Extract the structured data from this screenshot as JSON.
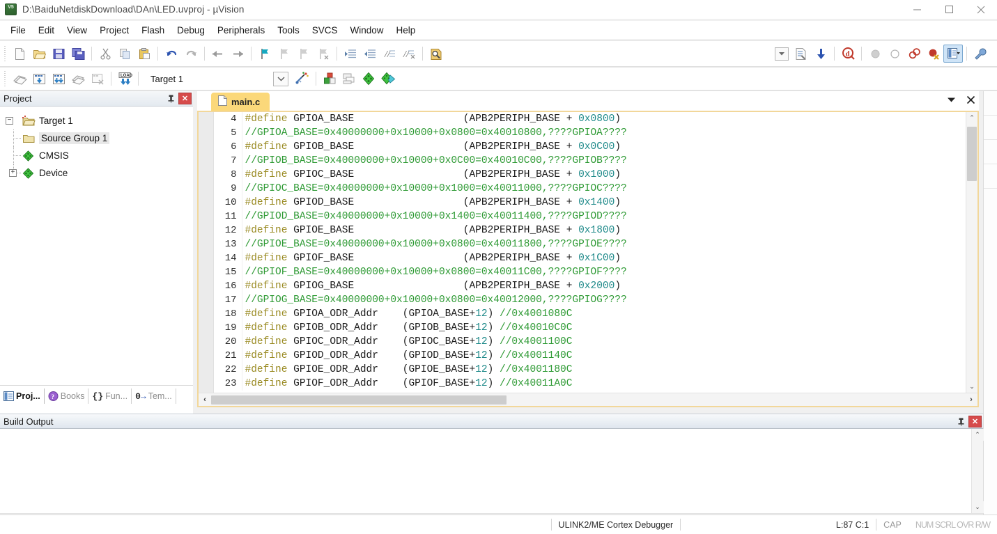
{
  "window": {
    "title": "D:\\BaiduNetdiskDownload\\DAn\\LED.uvproj - µVision",
    "icon": "uvision-logo-icon",
    "minimize": "—",
    "maximize": "□",
    "close": "✕"
  },
  "menu": {
    "items": [
      {
        "label": "File"
      },
      {
        "label": "Edit"
      },
      {
        "label": "View"
      },
      {
        "label": "Project"
      },
      {
        "label": "Flash"
      },
      {
        "label": "Debug"
      },
      {
        "label": "Peripherals"
      },
      {
        "label": "Tools"
      },
      {
        "label": "SVCS"
      },
      {
        "label": "Window"
      },
      {
        "label": "Help"
      }
    ]
  },
  "toolbar1": {
    "icons": [
      "new-file-icon",
      "open-file-icon",
      "save-icon",
      "save-all-icon",
      "cut-icon",
      "copy-icon",
      "paste-icon",
      "undo-icon",
      "redo-icon",
      "navigate-back-icon",
      "navigate-forward-icon",
      "bookmark-toggle-icon",
      "bookmark-prev-icon",
      "bookmark-next-icon",
      "bookmark-clear-icon",
      "indent-icon",
      "outdent-icon",
      "comment-icon",
      "uncomment-icon",
      "find-in-files-icon",
      "config-combo-icon",
      "target-options-icon",
      "download-icon",
      "start-debug-icon",
      "insert-breakpoint-icon",
      "disable-breakpoint-icon",
      "kill-breakpoints-icon",
      "disable-all-breakpoints-icon",
      "manage-windows-icon",
      "customize-tools-icon"
    ]
  },
  "toolbar2": {
    "icons": [
      "translate-icon",
      "build-icon",
      "rebuild-icon",
      "batch-build-icon",
      "stop-build-icon",
      "download-flash-icon"
    ],
    "target_value": "Target 1",
    "target_dropdown": "chevron-down-icon",
    "after_icons": [
      "target-options-icon",
      "manage-project-items-icon",
      "multi-project-icon",
      "pack-installer-icon",
      "manage-run-env-icon"
    ]
  },
  "project_panel": {
    "title": "Project",
    "pin_icon": "pin-icon",
    "close_icon": "close-icon",
    "tree": [
      {
        "label": "Target 1",
        "icon": "target-folder-icon",
        "expander": "−",
        "level": 0,
        "selected": false
      },
      {
        "label": "Source Group 1",
        "icon": "folder-icon",
        "expander": "",
        "level": 1,
        "selected": true
      },
      {
        "label": "CMSIS",
        "icon": "component-icon",
        "expander": "",
        "level": 1,
        "selected": false
      },
      {
        "label": "Device",
        "icon": "component-icon",
        "expander": "+",
        "level": 1,
        "selected": false
      }
    ]
  },
  "left_tabs": {
    "items": [
      {
        "label": "Proj...",
        "icon": "project-icon",
        "active": true
      },
      {
        "label": "Books",
        "icon": "books-icon",
        "active": false
      },
      {
        "label": "Fun...",
        "icon": "functions-icon",
        "active": false
      },
      {
        "label": "Tem...",
        "icon": "templates-icon",
        "active": false
      }
    ]
  },
  "editor": {
    "tab": {
      "label": "main.c",
      "icon": "c-file-icon"
    },
    "dropdown_icon": "chevron-down-icon",
    "close_icon": "close-icon",
    "lines": [
      {
        "n": "4",
        "tokens": [
          {
            "t": "#define ",
            "c": "def"
          },
          {
            "t": "GPIOA_BASE",
            "c": "id"
          },
          {
            "t": "                  (APB2PERIPH_BASE + ",
            "c": "id"
          },
          {
            "t": "0x0800",
            "c": "hex"
          },
          {
            "t": ")",
            "c": "id"
          }
        ]
      },
      {
        "n": "5",
        "tokens": [
          {
            "t": "//GPIOA_BASE=0x40000000+0x10000+0x0800=0x40010800,????GPIOA????",
            "c": "com"
          }
        ]
      },
      {
        "n": "6",
        "tokens": [
          {
            "t": "#define ",
            "c": "def"
          },
          {
            "t": "GPIOB_BASE",
            "c": "id"
          },
          {
            "t": "                  (APB2PERIPH_BASE + ",
            "c": "id"
          },
          {
            "t": "0x0C00",
            "c": "hex"
          },
          {
            "t": ")",
            "c": "id"
          }
        ]
      },
      {
        "n": "7",
        "tokens": [
          {
            "t": "//GPIOB_BASE=0x40000000+0x10000+0x0C00=0x40010C00,????GPIOB????",
            "c": "com"
          }
        ]
      },
      {
        "n": "8",
        "tokens": [
          {
            "t": "#define ",
            "c": "def"
          },
          {
            "t": "GPIOC_BASE",
            "c": "id"
          },
          {
            "t": "                  (APB2PERIPH_BASE + ",
            "c": "id"
          },
          {
            "t": "0x1000",
            "c": "hex"
          },
          {
            "t": ")",
            "c": "id"
          }
        ]
      },
      {
        "n": "9",
        "tokens": [
          {
            "t": "//GPIOC_BASE=0x40000000+0x10000+0x1000=0x40011000,????GPIOC????",
            "c": "com"
          }
        ]
      },
      {
        "n": "10",
        "tokens": [
          {
            "t": "#define ",
            "c": "def"
          },
          {
            "t": "GPIOD_BASE",
            "c": "id"
          },
          {
            "t": "                  (APB2PERIPH_BASE + ",
            "c": "id"
          },
          {
            "t": "0x1400",
            "c": "hex"
          },
          {
            "t": ")",
            "c": "id"
          }
        ]
      },
      {
        "n": "11",
        "tokens": [
          {
            "t": "//GPIOD_BASE=0x40000000+0x10000+0x1400=0x40011400,????GPIOD????",
            "c": "com"
          }
        ]
      },
      {
        "n": "12",
        "tokens": [
          {
            "t": "#define ",
            "c": "def"
          },
          {
            "t": "GPIOE_BASE",
            "c": "id"
          },
          {
            "t": "                  (APB2PERIPH_BASE + ",
            "c": "id"
          },
          {
            "t": "0x1800",
            "c": "hex"
          },
          {
            "t": ")",
            "c": "id"
          }
        ]
      },
      {
        "n": "13",
        "tokens": [
          {
            "t": "//GPIOE_BASE=0x40000000+0x10000+0x0800=0x40011800,????GPIOE????",
            "c": "com"
          }
        ]
      },
      {
        "n": "14",
        "tokens": [
          {
            "t": "#define ",
            "c": "def"
          },
          {
            "t": "GPIOF_BASE",
            "c": "id"
          },
          {
            "t": "                  (APB2PERIPH_BASE + ",
            "c": "id"
          },
          {
            "t": "0x1C00",
            "c": "hex"
          },
          {
            "t": ")",
            "c": "id"
          }
        ]
      },
      {
        "n": "15",
        "tokens": [
          {
            "t": "//GPIOF_BASE=0x40000000+0x10000+0x0800=0x40011C00,????GPIOF????",
            "c": "com"
          }
        ]
      },
      {
        "n": "16",
        "tokens": [
          {
            "t": "#define ",
            "c": "def"
          },
          {
            "t": "GPIOG_BASE",
            "c": "id"
          },
          {
            "t": "                  (APB2PERIPH_BASE + ",
            "c": "id"
          },
          {
            "t": "0x2000",
            "c": "hex"
          },
          {
            "t": ")",
            "c": "id"
          }
        ]
      },
      {
        "n": "17",
        "tokens": [
          {
            "t": "//GPIOG_BASE=0x40000000+0x10000+0x0800=0x40012000,????GPIOG????",
            "c": "com"
          }
        ]
      },
      {
        "n": "18",
        "tokens": [
          {
            "t": "#define ",
            "c": "def"
          },
          {
            "t": "GPIOA_ODR_Addr",
            "c": "id"
          },
          {
            "t": "    (GPIOA_BASE+",
            "c": "id"
          },
          {
            "t": "12",
            "c": "hex"
          },
          {
            "t": ") ",
            "c": "id"
          },
          {
            "t": "//0x4001080C",
            "c": "com"
          }
        ]
      },
      {
        "n": "19",
        "tokens": [
          {
            "t": "#define ",
            "c": "def"
          },
          {
            "t": "GPIOB_ODR_Addr",
            "c": "id"
          },
          {
            "t": "    (GPIOB_BASE+",
            "c": "id"
          },
          {
            "t": "12",
            "c": "hex"
          },
          {
            "t": ") ",
            "c": "id"
          },
          {
            "t": "//0x40010C0C",
            "c": "com"
          }
        ]
      },
      {
        "n": "20",
        "tokens": [
          {
            "t": "#define ",
            "c": "def"
          },
          {
            "t": "GPIOC_ODR_Addr",
            "c": "id"
          },
          {
            "t": "    (GPIOC_BASE+",
            "c": "id"
          },
          {
            "t": "12",
            "c": "hex"
          },
          {
            "t": ") ",
            "c": "id"
          },
          {
            "t": "//0x4001100C",
            "c": "com"
          }
        ]
      },
      {
        "n": "21",
        "tokens": [
          {
            "t": "#define ",
            "c": "def"
          },
          {
            "t": "GPIOD_ODR_Addr",
            "c": "id"
          },
          {
            "t": "    (GPIOD_BASE+",
            "c": "id"
          },
          {
            "t": "12",
            "c": "hex"
          },
          {
            "t": ") ",
            "c": "id"
          },
          {
            "t": "//0x4001140C",
            "c": "com"
          }
        ]
      },
      {
        "n": "22",
        "tokens": [
          {
            "t": "#define ",
            "c": "def"
          },
          {
            "t": "GPIOE_ODR_Addr",
            "c": "id"
          },
          {
            "t": "    (GPIOE_BASE+",
            "c": "id"
          },
          {
            "t": "12",
            "c": "hex"
          },
          {
            "t": ") ",
            "c": "id"
          },
          {
            "t": "//0x4001180C",
            "c": "com"
          }
        ]
      },
      {
        "n": "23",
        "tokens": [
          {
            "t": "#define ",
            "c": "def"
          },
          {
            "t": "GPIOF_ODR_Addr",
            "c": "id"
          },
          {
            "t": "    (GPIOF_BASE+",
            "c": "id"
          },
          {
            "t": "12",
            "c": "hex"
          },
          {
            "t": ") ",
            "c": "id"
          },
          {
            "t": "//0x40011A0C",
            "c": "com"
          }
        ]
      }
    ],
    "scroll": {
      "up_arrow": "⌃",
      "down_arrow": "⌄",
      "left_arrow": "‹",
      "right_arrow": "›"
    }
  },
  "build_output": {
    "title": "Build Output",
    "pin_icon": "pin-icon",
    "close_icon": "close-icon",
    "content": "",
    "scroll": {
      "up_arrow": "⌃",
      "down_arrow": "⌄",
      "left_arrow": "‹",
      "right_arrow": "›"
    }
  },
  "statusbar": {
    "debugger": "ULINK2/ME Cortex Debugger",
    "position": "L:87 C:1",
    "cap": "CAP",
    "indicators": "NUM SCRL OVR R/W"
  },
  "colors": {
    "keyword": "#9a8b23",
    "comment": "#2e9a34",
    "hex_literal": "#1f8a8a",
    "tab_active": "#fbd87a",
    "panel_close": "#d64b4b",
    "toolbar_active": "#cfe4f7"
  }
}
